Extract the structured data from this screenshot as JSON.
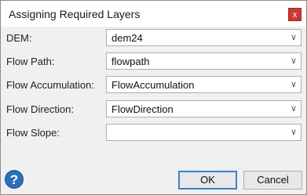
{
  "dialog": {
    "title": "Assigning Required Layers",
    "close_label": "x"
  },
  "fields": [
    {
      "label": "DEM:",
      "value": "dem24"
    },
    {
      "label": "Flow Path:",
      "value": "flowpath"
    },
    {
      "label": "Flow Accumulation:",
      "value": "FlowAccumulation"
    },
    {
      "label": "Flow Direction:",
      "value": "FlowDirection"
    },
    {
      "label": "Flow Slope:",
      "value": ""
    }
  ],
  "footer": {
    "help_label": "?",
    "ok_label": "OK",
    "cancel_label": "Cancel"
  },
  "icons": {
    "dropdown": "chevron-down-icon",
    "help": "help-icon",
    "close": "close-icon"
  },
  "colors": {
    "close_button": "#c53a32",
    "help_icon": "#2a6fba",
    "ok_focus_border": "#3c7fd1"
  }
}
